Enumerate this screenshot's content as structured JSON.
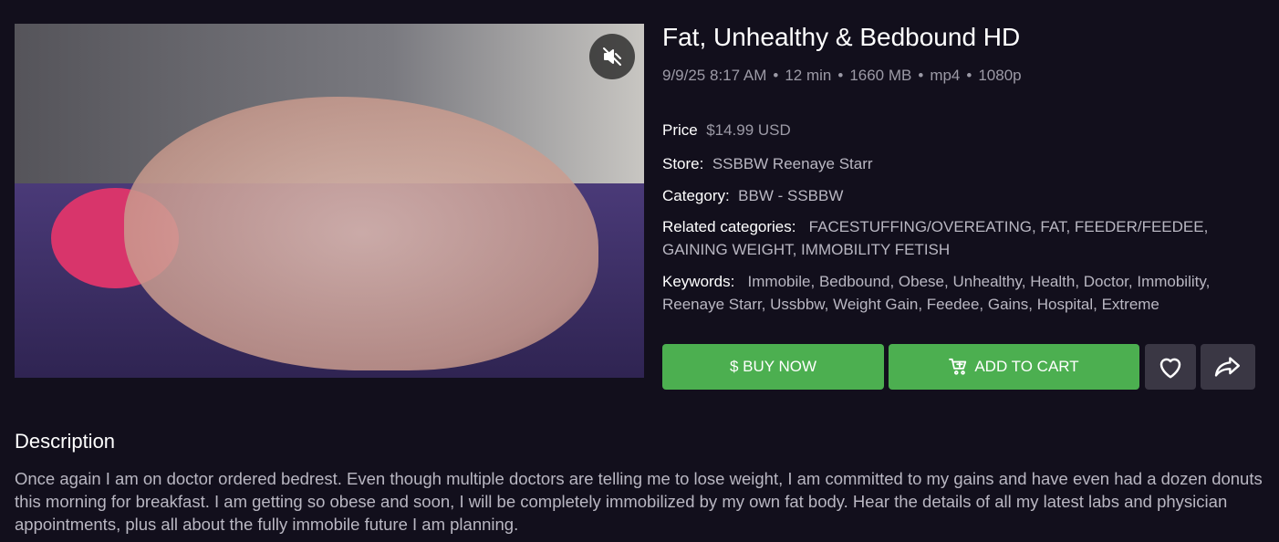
{
  "product": {
    "title": "Fat, Unhealthy & Bedbound HD",
    "meta": {
      "date": "9/9/25 8:17 AM",
      "duration": "12 min",
      "size": "1660 MB",
      "format": "mp4",
      "resolution": "1080p",
      "separator": "•"
    },
    "price": {
      "label": "Price",
      "value": "$14.99 USD"
    },
    "store": {
      "label": "Store:",
      "value": "SSBBW Reenaye Starr"
    },
    "category": {
      "label": "Category:",
      "value": "BBW - SSBBW"
    },
    "related": {
      "label": "Related categories:",
      "value": "FACESTUFFING/OVEREATING, FAT, FEEDER/FEEDEE, GAINING WEIGHT, IMMOBILITY FETISH"
    },
    "keywords": {
      "label": "Keywords:",
      "value": "Immobile, Bedbound, Obese, Unhealthy, Health, Doctor, Immobility, Reenaye Starr, Ussbbw, Weight Gain, Feedee, Gains, Hospital, Extreme"
    }
  },
  "actions": {
    "buy_label": "$ BUY NOW",
    "cart_label": "ADD TO CART",
    "favorite_icon": "heart-icon",
    "share_icon": "share-icon"
  },
  "preview": {
    "mute_icon": "muted-speaker-icon"
  },
  "description": {
    "heading": "Description",
    "text": "Once again I am on doctor ordered bedrest. Even though multiple doctors are telling me to lose weight, I am committed to my gains and have even had a dozen donuts this morning for breakfast. I am getting so obese and soon, I will be completely immobilized by my own fat body. Hear the details of all my latest labs and physician appointments, plus all about the fully immobile future I am planning."
  },
  "colors": {
    "background": "#120f1c",
    "accent_green": "#4caf50",
    "button_gray": "#3a3744",
    "muted_text": "#9c9aa6"
  }
}
